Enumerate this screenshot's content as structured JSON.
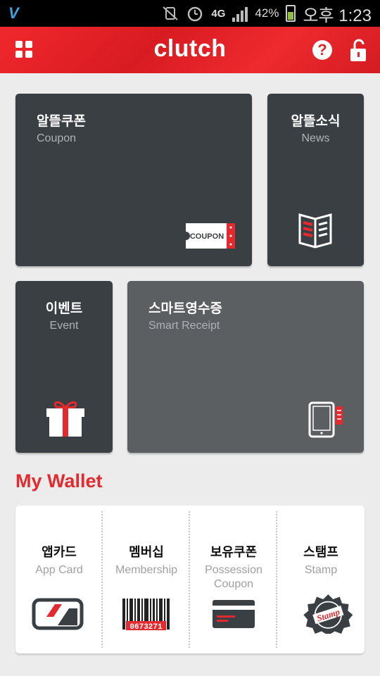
{
  "status_bar": {
    "carrier_logo": "V",
    "network": "4G",
    "battery": "42%",
    "time": "오후 1:23"
  },
  "header": {
    "title": "clutch",
    "menu_icon": "grid-icon",
    "help_icon": "help-icon",
    "help_glyph": "?",
    "lock_icon": "unlock-icon"
  },
  "tiles": [
    {
      "ko": "알뜰쿠폰",
      "en": "Coupon",
      "icon": "coupon-icon",
      "icon_text": "COUPON"
    },
    {
      "ko": "알뜰소식",
      "en": "News",
      "icon": "news-book-icon"
    },
    {
      "ko": "이벤트",
      "en": "Event",
      "icon": "gift-icon"
    },
    {
      "ko": "스마트영수증",
      "en": "Smart Receipt",
      "icon": "tablet-receipt-icon"
    }
  ],
  "wallet": {
    "title": "My Wallet",
    "items": [
      {
        "ko": "앱카드",
        "en": "App Card",
        "icon": "app-card-icon"
      },
      {
        "ko": "멤버십",
        "en": "Membership",
        "icon": "barcode-icon",
        "barcode_number": "0673271"
      },
      {
        "ko": "보유쿠폰",
        "en": "Possession Coupon",
        "icon": "card-icon"
      },
      {
        "ko": "스탬프",
        "en": "Stamp",
        "icon": "stamp-icon",
        "stamp_text": "Stamp"
      }
    ]
  },
  "colors": {
    "brand_red": "#e42a2e",
    "tile_dark": "#3a3f44",
    "tile_gray": "#5c5f62",
    "background": "#ececec"
  }
}
